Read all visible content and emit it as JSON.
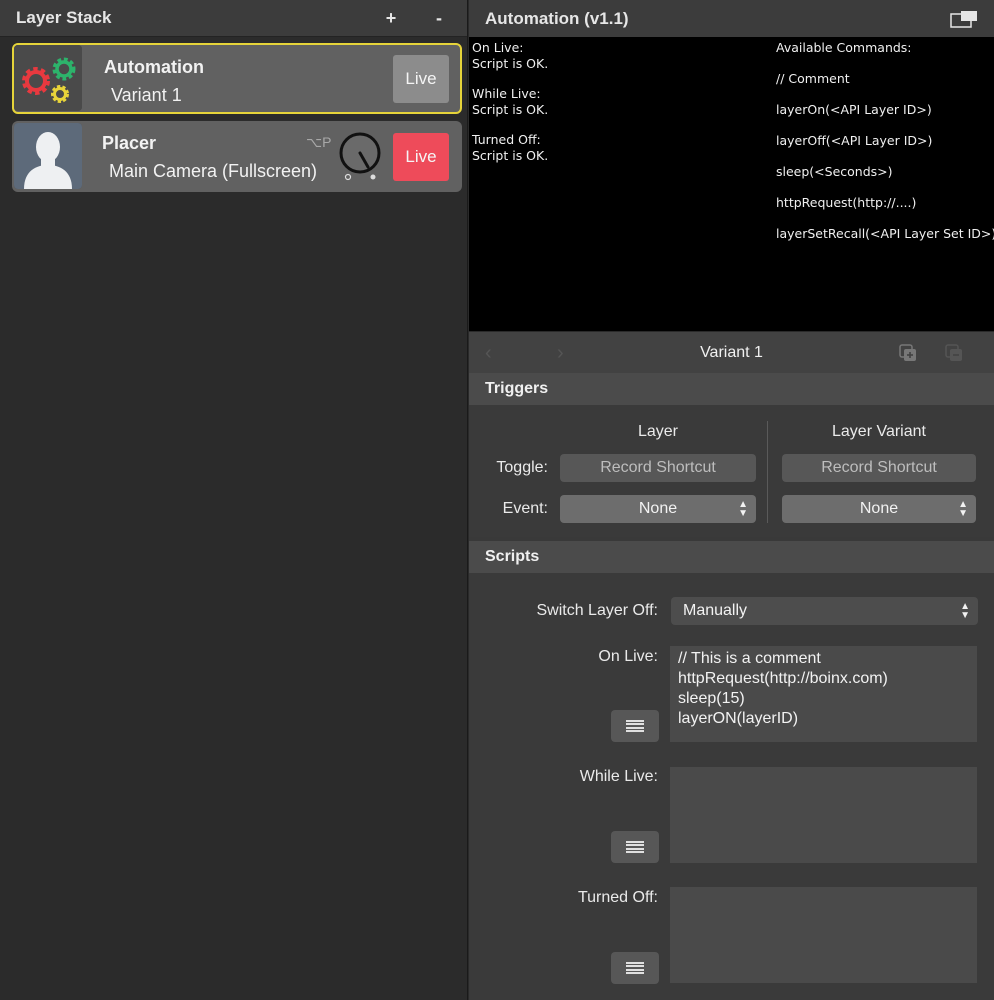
{
  "left_panel": {
    "title": "Layer Stack",
    "add_label": "+",
    "remove_label": "-",
    "layers": [
      {
        "name": "Automation",
        "variant": "Variant 1",
        "live_label": "Live",
        "live": false,
        "selected": true,
        "icon": "gears-icon"
      },
      {
        "name": "Placer",
        "variant": "Main Camera (Fullscreen)",
        "live_label": "Live",
        "live": true,
        "shortcut": "⌥P",
        "icon": "person-silhouette-icon"
      }
    ]
  },
  "right_panel": {
    "title": "Automation (v1.1)",
    "console": {
      "status": [
        {
          "label": "On Live:",
          "message": "Script is OK."
        },
        {
          "label": "While Live:",
          "message": "Script is OK."
        },
        {
          "label": "Turned Off:",
          "message": "Script is OK."
        }
      ],
      "commands_title": "Available Commands:",
      "commands": [
        "// Comment",
        "layerOn(<API Layer ID>)",
        "layerOff(<API Layer ID>)",
        "sleep(<Seconds>)",
        "httpRequest(http://....)",
        "layerSetRecall(<API Layer Set ID>)"
      ]
    },
    "variant_bar": {
      "title": "Variant 1",
      "prev": "‹",
      "next": "›"
    },
    "triggers": {
      "title": "Triggers",
      "layer_col": "Layer",
      "variant_col": "Layer Variant",
      "toggle_label": "Toggle:",
      "event_label": "Event:",
      "record_label": "Record Shortcut",
      "layer_event": "None",
      "variant_event": "None"
    },
    "scripts": {
      "title": "Scripts",
      "switch_off_label": "Switch Layer Off:",
      "switch_off_value": "Manually",
      "on_live_label": "On Live:",
      "on_live_script": "// This is a comment\nhttpRequest(http://boinx.com)\nsleep(15)\nlayerON(layerID)",
      "while_live_label": "While Live:",
      "while_live_script": "",
      "turned_off_label": "Turned Off:",
      "turned_off_script": ""
    }
  },
  "colors": {
    "live_on": "#ee4b5a",
    "live_off": "#8c8c8c",
    "selection": "#e6d43a",
    "gear_red": "#e8393f",
    "gear_green": "#2db36b",
    "gear_yellow": "#e8d43a"
  }
}
